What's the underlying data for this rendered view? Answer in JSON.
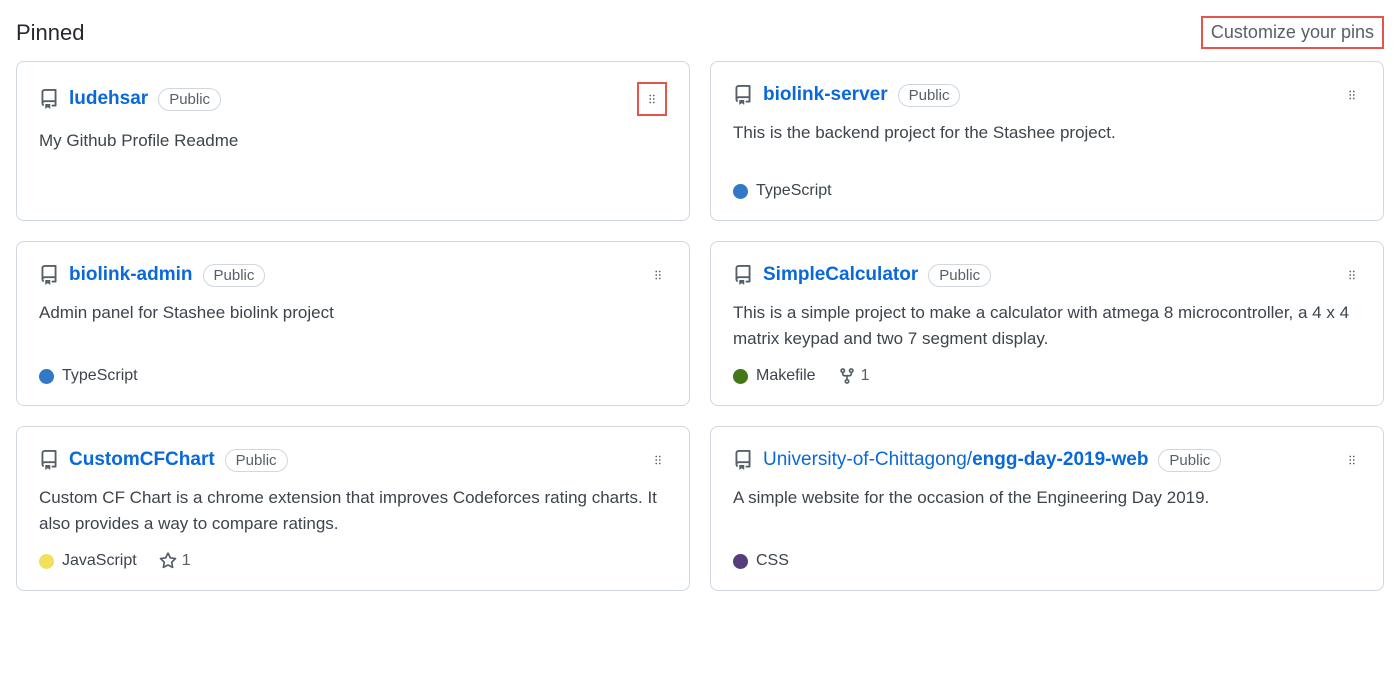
{
  "section": {
    "title": "Pinned",
    "customize": "Customize your pins"
  },
  "langColors": {
    "TypeScript": "#3178c6",
    "Makefile": "#427819",
    "JavaScript": "#f1e05a",
    "CSS": "#563d7c"
  },
  "repos": [
    {
      "name": "ludehsar",
      "visibility": "Public",
      "description": "My Github Profile Readme",
      "language": null,
      "stars": null,
      "forks": null,
      "highlightDrag": true
    },
    {
      "name": "biolink-server",
      "visibility": "Public",
      "description": "This is the backend project for the Stashee project.",
      "language": "TypeScript",
      "stars": null,
      "forks": null,
      "highlightDrag": false
    },
    {
      "name": "biolink-admin",
      "visibility": "Public",
      "description": "Admin panel for Stashee biolink project",
      "language": "TypeScript",
      "stars": null,
      "forks": null,
      "highlightDrag": false
    },
    {
      "name": "SimpleCalculator",
      "visibility": "Public",
      "description": "This is a simple project to make a calculator with atmega 8 microcontroller, a 4 x 4 matrix keypad and two 7 segment display.",
      "language": "Makefile",
      "stars": null,
      "forks": 1,
      "highlightDrag": false
    },
    {
      "name": "CustomCFChart",
      "visibility": "Public",
      "description": "Custom CF Chart is a chrome extension that improves Codeforces rating charts. It also provides a way to compare ratings.",
      "language": "JavaScript",
      "stars": 1,
      "forks": null,
      "highlightDrag": false
    },
    {
      "prefix": "University-of-Chittagong/",
      "name": "engg-day-2019-web",
      "visibility": "Public",
      "description": "A simple website for the occasion of the Engineering Day 2019.",
      "language": "CSS",
      "stars": null,
      "forks": null,
      "highlightDrag": false
    }
  ]
}
